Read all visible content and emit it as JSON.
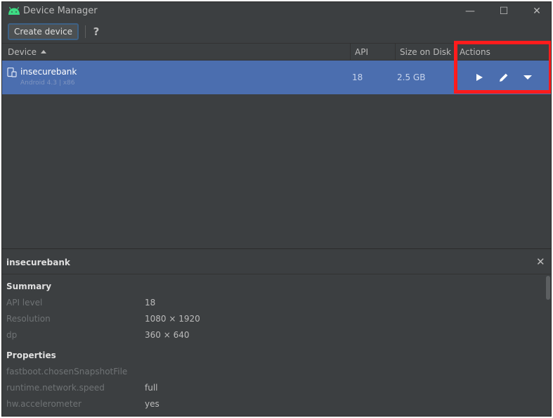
{
  "window": {
    "title": "Device Manager",
    "controls": {
      "minimize": "—",
      "maximize": "☐",
      "close": "✕"
    }
  },
  "toolbar": {
    "create_label": "Create device",
    "help_label": "?"
  },
  "table": {
    "columns": {
      "device": "Device",
      "api": "API",
      "size": "Size on Disk",
      "actions": "Actions"
    },
    "sort": "ascending",
    "rows": [
      {
        "name": "insecurebank",
        "subtitle": "Android 4.3 | x86",
        "api": "18",
        "size": "2.5 GB"
      }
    ]
  },
  "details": {
    "title": "insecurebank",
    "close": "✕",
    "summary_label": "Summary",
    "summary": [
      {
        "key": "API level",
        "value": "18"
      },
      {
        "key": "Resolution",
        "value": "1080 × 1920"
      },
      {
        "key": "dp",
        "value": "360 × 640"
      }
    ],
    "properties_label": "Properties",
    "properties": [
      {
        "key": "fastboot.chosenSnapshotFile",
        "value": ""
      },
      {
        "key": "runtime.network.speed",
        "value": "full"
      },
      {
        "key": "hw.accelerometer",
        "value": "yes"
      }
    ]
  },
  "colors": {
    "background": "#3c3f41",
    "selection": "#4b6eaf",
    "highlight": "#ff1c1c",
    "android_green": "#3ddc84"
  },
  "icons": {
    "app": "android-icon",
    "device": "device-phone-icon",
    "run": "play-icon",
    "edit": "pencil-icon",
    "more": "chevron-down-icon"
  }
}
